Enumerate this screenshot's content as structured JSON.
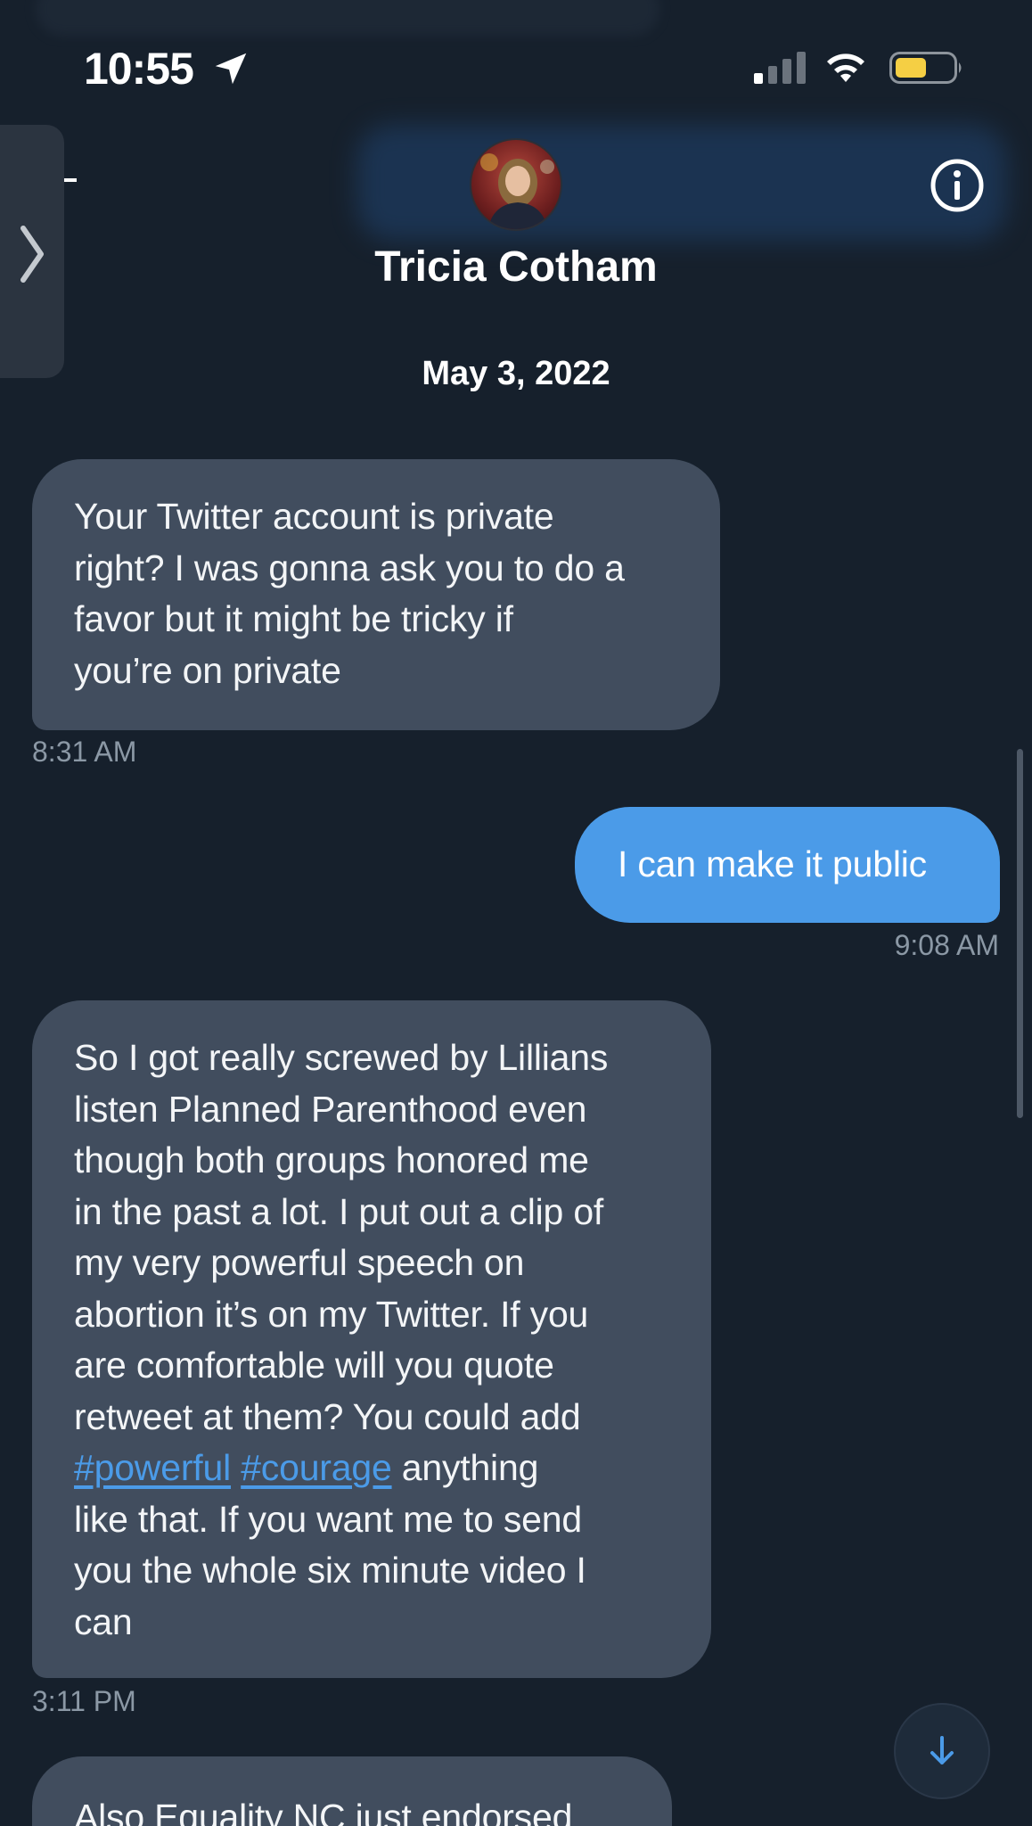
{
  "status_bar": {
    "time": "10:55",
    "icons": [
      "location-arrow-icon",
      "cellular-signal-icon",
      "wifi-icon",
      "battery-icon"
    ],
    "battery_color": "#f5cf44"
  },
  "header": {
    "contact_name": "Tricia Cotham",
    "left_dash": "-",
    "icons": [
      "chevron-right-icon",
      "avatar",
      "info-icon"
    ]
  },
  "conversation": {
    "date_separator": "May 3, 2022",
    "messages": [
      {
        "direction": "received",
        "lines": [
          "Your Twitter account is private",
          "right? I was gonna ask you to do a",
          "favor but it might be tricky if",
          "you’re on private"
        ],
        "time": "8:31 AM"
      },
      {
        "direction": "sent",
        "text": "I can make it public",
        "time": "9:08 AM"
      },
      {
        "direction": "received",
        "lines": [
          "So I got really screwed by Lillians",
          "listen Planned Parenthood even",
          "though both groups honored me",
          "in the past a lot. I put out a clip of",
          "my very powerful speech on",
          "abortion it’s on my Twitter. If you",
          "are comfortable will you quote",
          "retweet at them? You could add"
        ],
        "hashtag_line": {
          "tag1": "#powerful",
          "tag2": "#courage",
          "rest": " anything"
        },
        "lines_after": [
          "like that. If you want me to send",
          "you the whole six minute video I",
          "can"
        ],
        "time": "3:11 PM"
      },
      {
        "direction": "received",
        "text": "Also Equality NC just endorsed"
      }
    ]
  },
  "colors": {
    "background": "#16202c",
    "received_bubble": "#414d5e",
    "sent_bubble": "#4b9be8",
    "timestamp": "#8b98a5",
    "hashtag": "#4b9be8"
  }
}
